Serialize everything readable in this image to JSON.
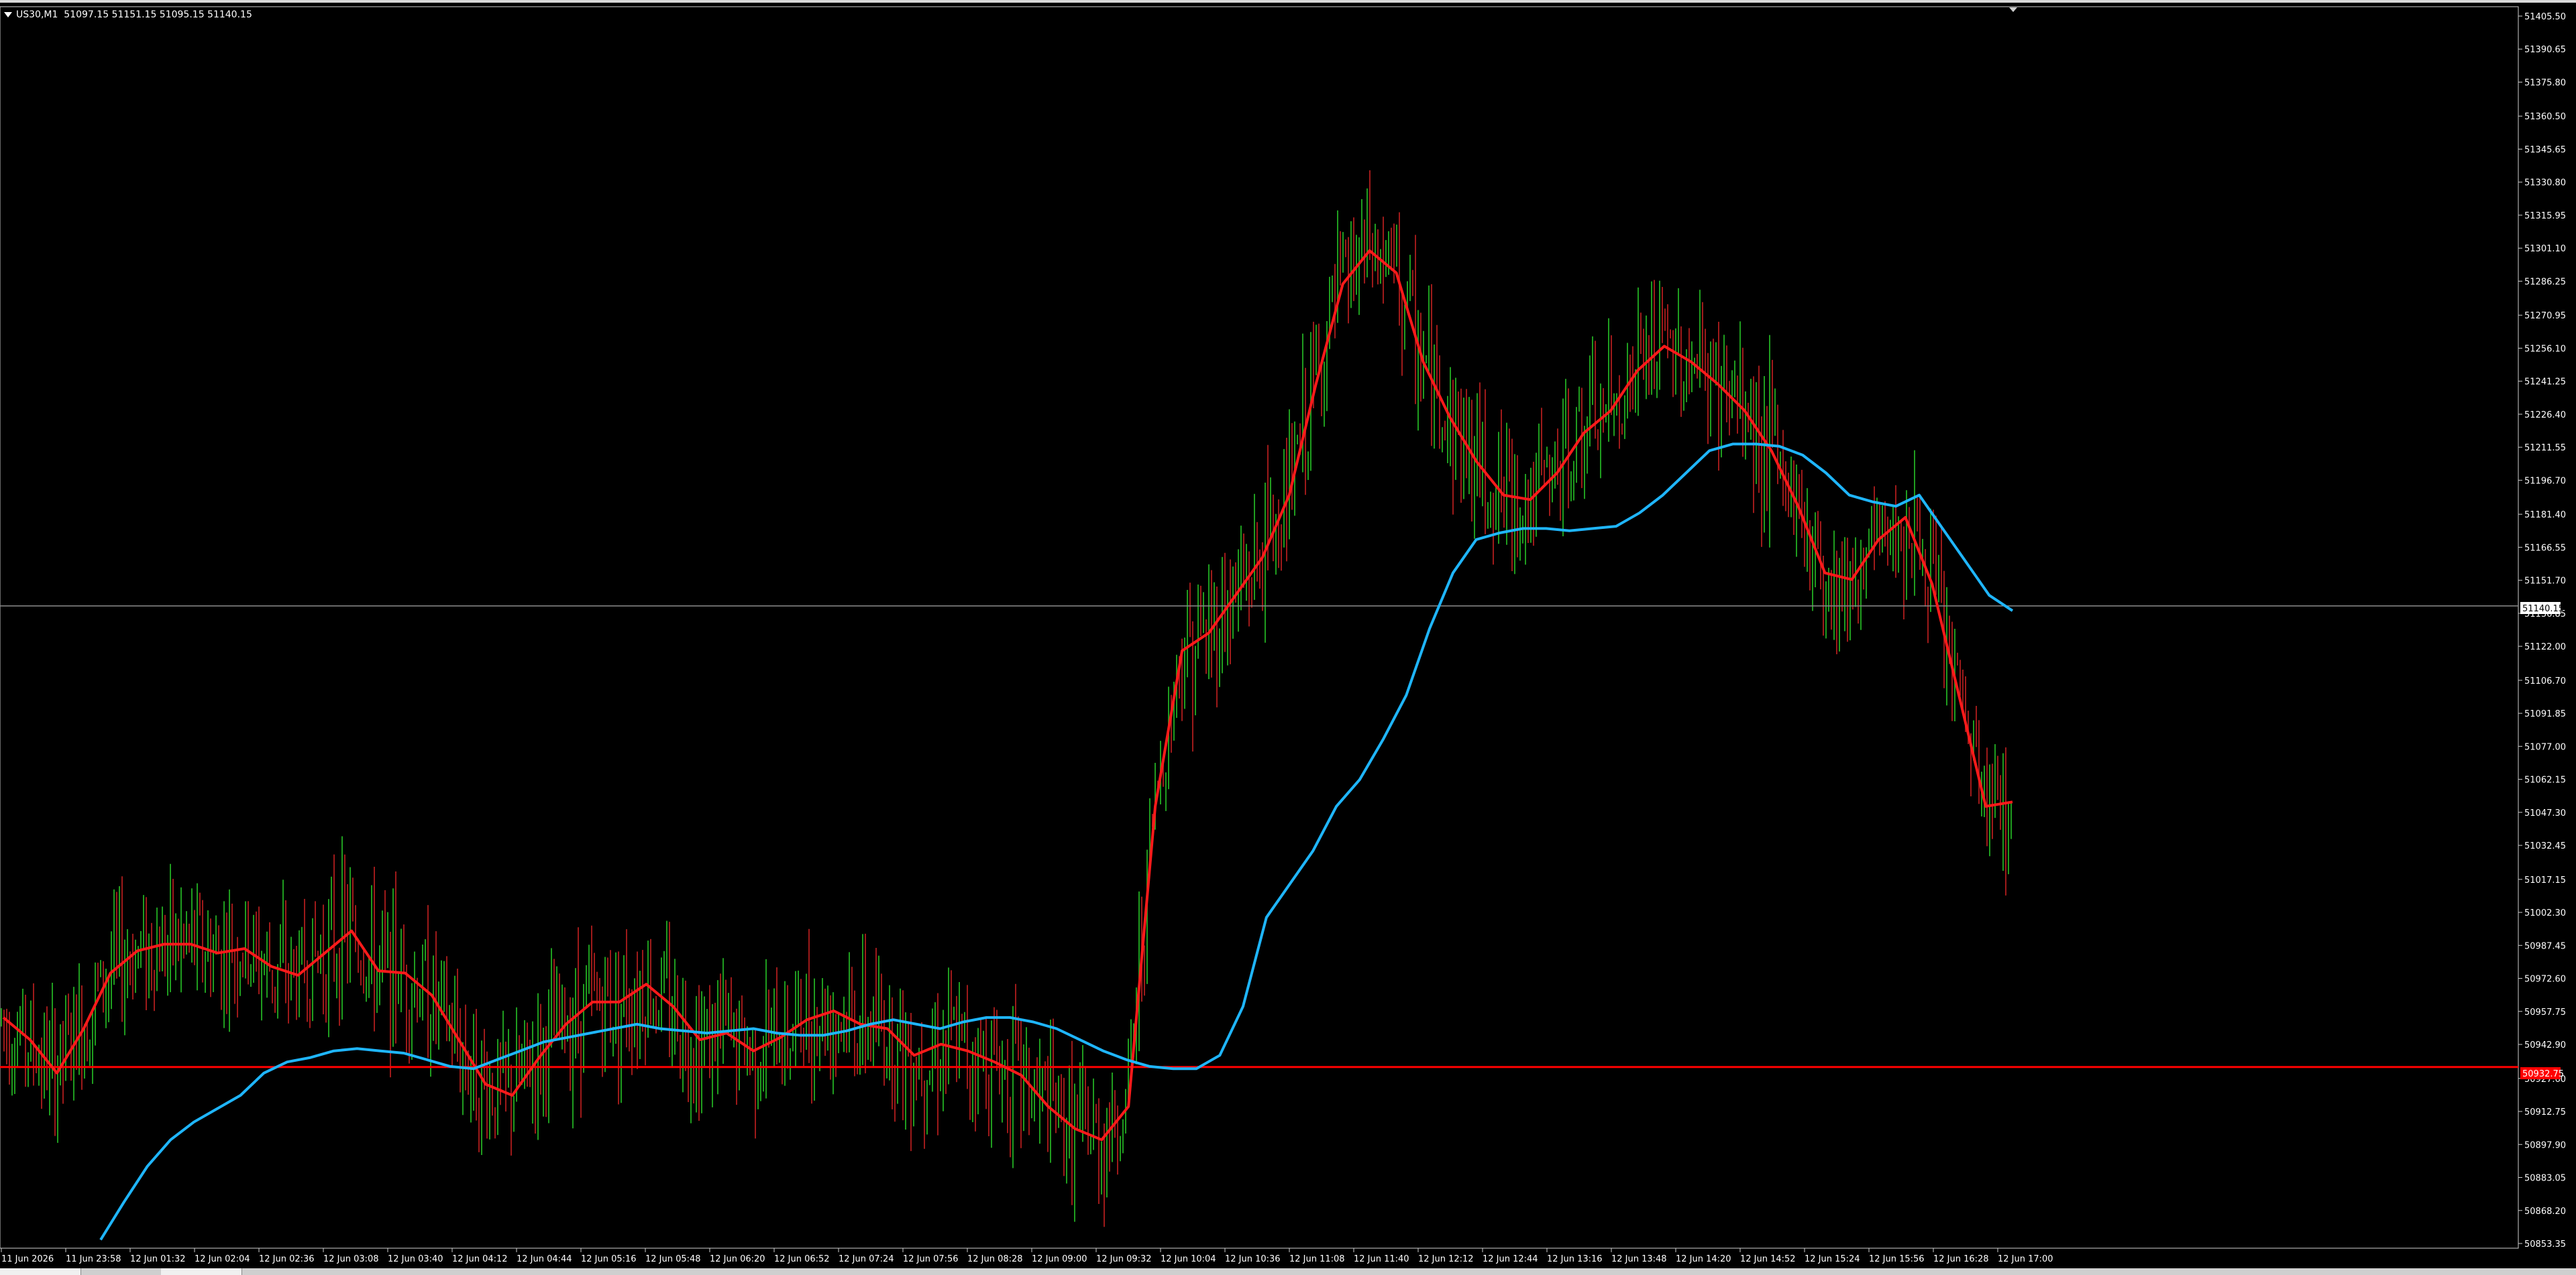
{
  "header": {
    "symbol": "US30,M1",
    "ohlc": "51097.15 51151.15 51095.15 51140.15"
  },
  "price_labels": {
    "current": "51140.15",
    "red_line": "50932.75"
  },
  "chart_data": {
    "type": "line",
    "title": "US30,M1",
    "y_axis_ticks": [
      51405.5,
      51390.65,
      51375.8,
      51360.5,
      51345.65,
      51330.8,
      51315.95,
      51301.1,
      51286.25,
      51270.95,
      51256.1,
      51241.25,
      51226.4,
      51211.55,
      51196.7,
      51181.4,
      51166.55,
      51151.7,
      51136.85,
      51122.0,
      51106.7,
      51091.85,
      51077.0,
      51062.15,
      51047.3,
      51032.45,
      51017.15,
      51002.3,
      50987.45,
      50972.6,
      50957.75,
      50942.9,
      50927.6,
      50912.75,
      50897.9,
      50883.05,
      50868.2,
      50853.35
    ],
    "ylim": [
      50853.35,
      51405.5
    ],
    "x_axis_ticks": [
      "11 Jun 2026",
      "11 Jun 23:58",
      "12 Jun 01:32",
      "12 Jun 02:04",
      "12 Jun 02:36",
      "12 Jun 03:08",
      "12 Jun 03:40",
      "12 Jun 04:12",
      "12 Jun 04:44",
      "12 Jun 05:16",
      "12 Jun 05:48",
      "12 Jun 06:20",
      "12 Jun 06:52",
      "12 Jun 07:24",
      "12 Jun 07:56",
      "12 Jun 08:28",
      "12 Jun 09:00",
      "12 Jun 09:32",
      "12 Jun 10:04",
      "12 Jun 10:36",
      "12 Jun 11:08",
      "12 Jun 11:40",
      "12 Jun 12:12",
      "12 Jun 12:44",
      "12 Jun 13:16",
      "12 Jun 13:48",
      "12 Jun 14:20",
      "12 Jun 14:52",
      "12 Jun 15:24",
      "12 Jun 15:56",
      "12 Jun 16:28",
      "12 Jun 17:00"
    ],
    "horizontal_lines": [
      {
        "value": 51140.15,
        "color": "#8c8c8c"
      },
      {
        "value": 50932.75,
        "color": "#ff0000"
      }
    ],
    "series": [
      {
        "color": "#ff1a1a",
        "values": [
          50955,
          50945,
          50930,
          50950,
          50975,
          50985,
          50988,
          50988,
          50984,
          50986,
          50978,
          50974,
          50984,
          50994,
          50976,
          50975,
          50965,
          50945,
          50925,
          50920,
          50937,
          50952,
          50962,
          50962,
          50970,
          50960,
          50945,
          50948,
          50940,
          50946,
          50954,
          50958,
          50952,
          50950,
          50938,
          50943,
          50940,
          50935,
          50929,
          50915,
          50905,
          50900,
          50915,
          51050,
          51120,
          51128,
          51145,
          51162,
          51190,
          51240,
          51285,
          51300,
          51290,
          51250,
          51225,
          51205,
          51190,
          51188,
          51200,
          51218,
          51228,
          51246,
          51257,
          51250,
          51240,
          51228,
          51210,
          51185,
          51155,
          51152,
          51170,
          51180,
          51150,
          51100,
          51050,
          51052
        ]
      },
      {
        "color": "#1fb6ff",
        "values": [
          50855,
          50872,
          50888,
          50900,
          50908,
          50914,
          50920,
          50930,
          50935,
          50937,
          50940,
          50941,
          50940,
          50939,
          50936,
          50933,
          50932,
          50936,
          50940,
          50944,
          50946,
          50948,
          50950,
          50952,
          50950,
          50949,
          50948,
          50949,
          50950,
          50948,
          50947,
          50947,
          50949,
          50952,
          50954,
          50952,
          50950,
          50953,
          50955,
          50955,
          50953,
          50950,
          50945,
          50940,
          50936,
          50933,
          50932,
          50932,
          50938,
          50960,
          51000,
          51015,
          51030,
          51050,
          51062,
          51080,
          51100,
          51130,
          51155,
          51170,
          51173,
          51175,
          51175,
          51174,
          51175,
          51176,
          51182,
          51190,
          51200,
          51210,
          51213,
          51213,
          51212,
          51208,
          51200,
          51190,
          51187,
          51185,
          51190,
          51175,
          51160,
          51145,
          51138
        ]
      }
    ]
  }
}
